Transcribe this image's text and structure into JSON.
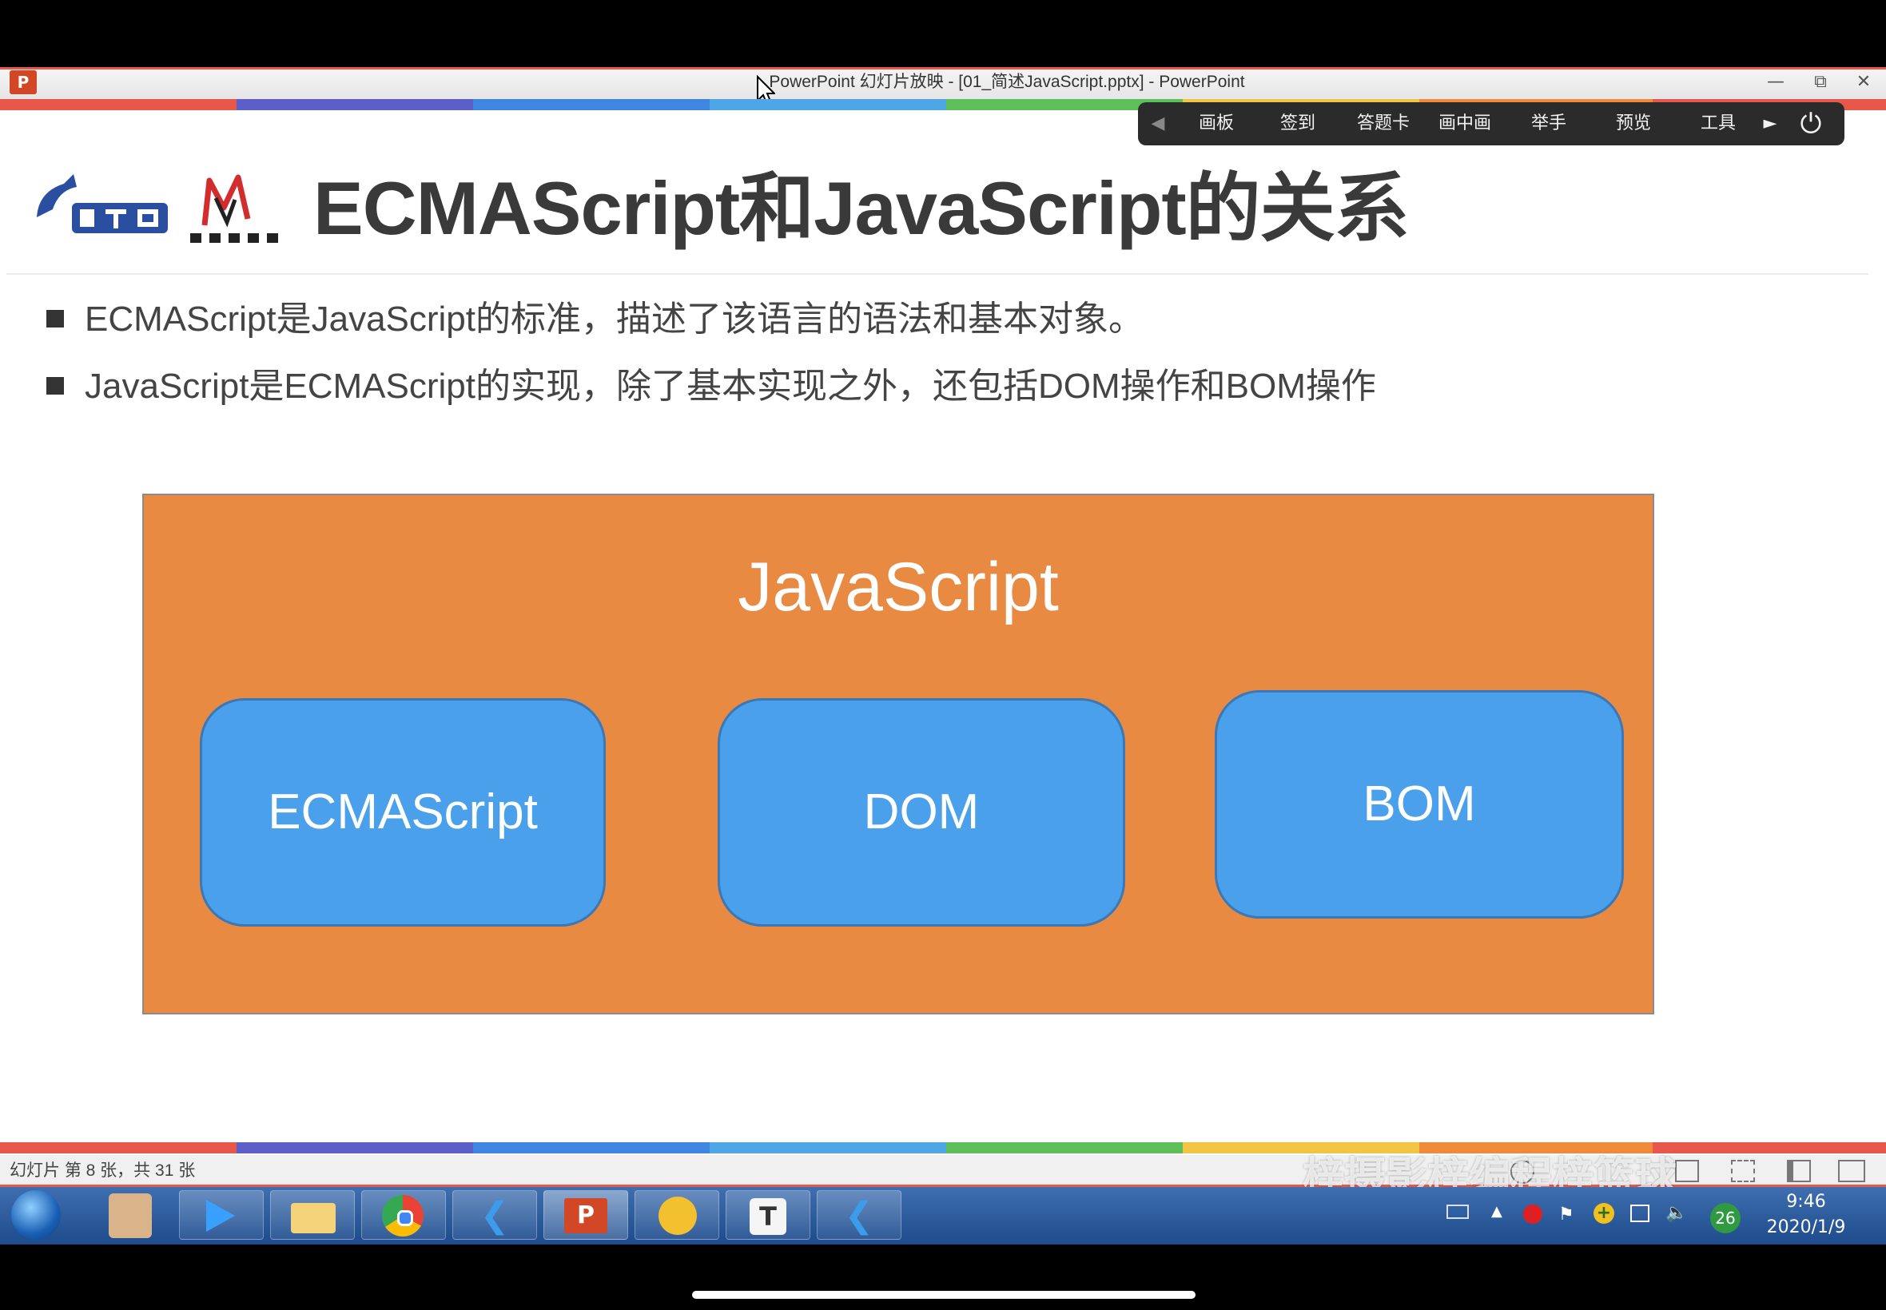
{
  "window": {
    "title": "PowerPoint 幻灯片放映 - [01_简述JavaScript.pptx] - PowerPoint",
    "app_icon_label": "P",
    "minimize_icon": "minimize-icon",
    "restore_icon": "restore-icon",
    "close_icon": "close-icon"
  },
  "toolbar": {
    "items": [
      {
        "label": "画板"
      },
      {
        "label": "签到"
      },
      {
        "label": "答题卡"
      },
      {
        "label": "画中画"
      },
      {
        "label": "举手"
      },
      {
        "label": "预览"
      },
      {
        "label": "工具"
      }
    ],
    "power_icon": "power-icon"
  },
  "slide": {
    "title": "ECMAScript和JavaScript的关系",
    "bullets": [
      "ECMAScript是JavaScript的标准，描述了该语言的语法和基本对象。",
      "JavaScript是ECMAScript的实现，除了基本实现之外，还包括DOM操作和BOM操作"
    ],
    "diagram": {
      "outer_label": "JavaScript",
      "boxes": [
        "ECMAScript",
        "DOM",
        "BOM"
      ]
    }
  },
  "status": {
    "slide_position": "幻灯片 第 8 张，共 31 张",
    "watermark": "梓摄影梓编程梓篮球"
  },
  "taskbar": {
    "time": "9:46",
    "date": "2020/1/9",
    "tray_badge": "26"
  },
  "colors": {
    "diagram_outer": "#e88a42",
    "diagram_inner": "#4aa0ea",
    "frame_accent": "#e8584a"
  }
}
